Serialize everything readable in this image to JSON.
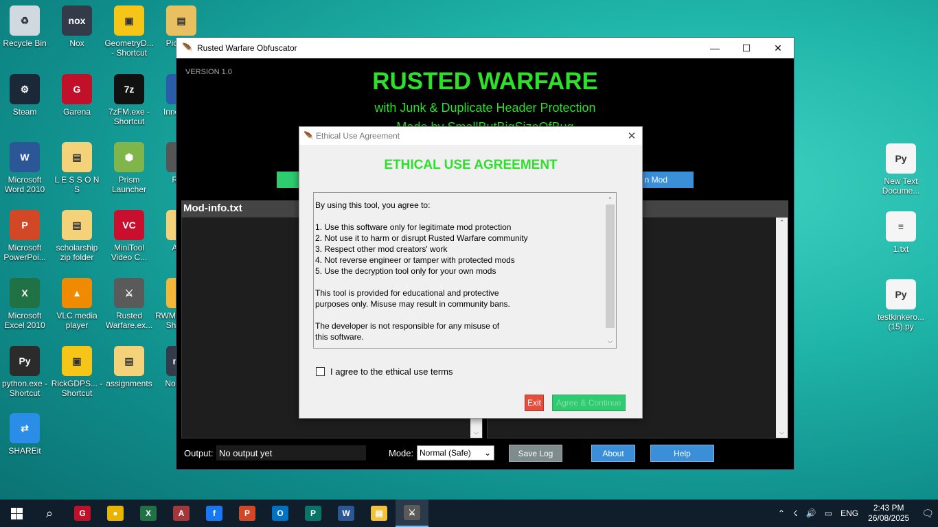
{
  "desktop_icons": [
    {
      "name": "recycle-bin",
      "label": "Recycle Bin",
      "color": "#d0d8e0",
      "glyph": "♻"
    },
    {
      "name": "nox",
      "label": "Nox",
      "color": "#333a4a",
      "glyph": "nox"
    },
    {
      "name": "geometryd-shortcut",
      "label": "GeometryD... - Shortcut",
      "color": "#f5c518",
      "glyph": "▣"
    },
    {
      "name": "pictures-shortcut",
      "label": "Pict Sho",
      "color": "#e8c060",
      "glyph": "▤"
    },
    {
      "name": "steam",
      "label": "Steam",
      "color": "#1b2838",
      "glyph": "⚙"
    },
    {
      "name": "garena",
      "label": "Garena",
      "color": "#c0102a",
      "glyph": "G"
    },
    {
      "name": "7zfm-shortcut",
      "label": "7zFM.exe - Shortcut",
      "color": "#111111",
      "glyph": "7z"
    },
    {
      "name": "inno-compiler",
      "label": "Inno Com",
      "color": "#2a5caa",
      "glyph": "e"
    },
    {
      "name": "word-2010",
      "label": "Microsoft Word 2010",
      "color": "#2b5797",
      "glyph": "W"
    },
    {
      "name": "lessons",
      "label": "L E S S O N S",
      "color": "#f3d27a",
      "glyph": "▤"
    },
    {
      "name": "prism-launcher",
      "label": "Prism Launcher",
      "color": "#7fb54a",
      "glyph": "⬢"
    },
    {
      "name": "rwa",
      "label": "RWA",
      "color": "#555555",
      "glyph": "▲"
    },
    {
      "name": "powerpoint",
      "label": "Microsoft PowerPoi...",
      "color": "#d24726",
      "glyph": "P"
    },
    {
      "name": "scholarship-zip",
      "label": "scholarship zip folder",
      "color": "#f3d27a",
      "glyph": "▤"
    },
    {
      "name": "minitool-video",
      "label": "MiniTool Video C...",
      "color": "#c8102e",
      "glyph": "VC"
    },
    {
      "name": "arwo",
      "label": "Arwo",
      "color": "#f3d27a",
      "glyph": "▤"
    },
    {
      "name": "excel-2010",
      "label": "Microsoft Excel 2010",
      "color": "#207245",
      "glyph": "X"
    },
    {
      "name": "vlc",
      "label": "VLC media player",
      "color": "#f08a00",
      "glyph": "▲"
    },
    {
      "name": "rusted-warfare",
      "label": "Rusted Warfare.ex...",
      "color": "#5a5a5a",
      "glyph": "⚔"
    },
    {
      "name": "rwmod-shortcut",
      "label": "RWMod_R... - Shortcut",
      "color": "#f3b73a",
      "glyph": "▤"
    },
    {
      "name": "python-shortcut",
      "label": "python.exe - Shortcut",
      "color": "#2b2b2b",
      "glyph": "Py"
    },
    {
      "name": "rickgdps-shortcut",
      "label": "RickGDPS... - Shortcut",
      "color": "#f5c518",
      "glyph": "▣"
    },
    {
      "name": "assignments",
      "label": "assignments",
      "color": "#f3d27a",
      "glyph": "▤"
    },
    {
      "name": "nox-asst",
      "label": "Nox Asst",
      "color": "#333a4a",
      "glyph": "nox"
    },
    {
      "name": "shareit",
      "label": "SHAREit",
      "color": "#2a8ee8",
      "glyph": "⇄"
    },
    {
      "name": "new-text-document",
      "label": "New Text Docume...",
      "color": "#f5f5f5",
      "glyph": "Py"
    },
    {
      "name": "1-txt",
      "label": "1.txt",
      "color": "#f5f5f5",
      "glyph": "≡"
    },
    {
      "name": "testkinkero-py",
      "label": "testkinkero... (15).py",
      "color": "#f5f5f5",
      "glyph": "Py"
    }
  ],
  "window": {
    "title": "Rusted Warfare Obfuscator",
    "minimize": "—",
    "maximize": "☐",
    "close": "✕",
    "version": "VERSION 1.0",
    "heading": "RUSTED WARFARE",
    "subtitle": "with Junk & Duplicate Header Protection",
    "made_by": "Made by SmallButBigSizeOfBug",
    "partial_button": "n Mod",
    "panel_left_title": "Mod-info.txt",
    "output_label": "Output:",
    "output_value": "No output yet",
    "mode_label": "Mode:",
    "mode_value": "Normal (Safe)",
    "save_log": "Save Log",
    "about": "About",
    "help": "Help"
  },
  "dialog": {
    "title": "Ethical Use Agreement",
    "close": "✕",
    "heading": "ETHICAL USE AGREEMENT",
    "intro": "By using this tool, you agree to:",
    "rules": [
      "1. Use this software only for legitimate mod protection",
      "2. Not use it to harm or disrupt Rusted Warfare community",
      "3. Respect other mod creators' work",
      "4. Not reverse engineer or tamper with protected mods",
      "5. Use the decryption tool only for your own mods"
    ],
    "para2_line1": "This tool is provided for educational and protective",
    "para2_line2": "purposes only. Misuse may result in community bans.",
    "para3_line1": "The developer is not responsible for any misuse of",
    "para3_line2": "this software.",
    "checkbox_label": "I agree to the ethical use terms",
    "exit": "Exit",
    "agree": "Agree & Continue"
  },
  "taskbar": {
    "apps": [
      {
        "name": "garena",
        "color": "#c0102a",
        "glyph": "G"
      },
      {
        "name": "chrome",
        "color": "#e8b400",
        "glyph": "●"
      },
      {
        "name": "excel",
        "color": "#207245",
        "glyph": "X"
      },
      {
        "name": "access",
        "color": "#a4373a",
        "glyph": "A"
      },
      {
        "name": "facebook",
        "color": "#1877f2",
        "glyph": "f"
      },
      {
        "name": "powerpoint",
        "color": "#d24726",
        "glyph": "P"
      },
      {
        "name": "outlook",
        "color": "#0072c6",
        "glyph": "O"
      },
      {
        "name": "publisher",
        "color": "#077568",
        "glyph": "P"
      },
      {
        "name": "word",
        "color": "#2b5797",
        "glyph": "W"
      },
      {
        "name": "file-explorer",
        "color": "#f3c13a",
        "glyph": "▤"
      },
      {
        "name": "rusted-warfare",
        "color": "#5a5a5a",
        "glyph": "⚔"
      }
    ],
    "language": "ENG",
    "time": "2:43 PM",
    "date": "26/08/2025"
  }
}
